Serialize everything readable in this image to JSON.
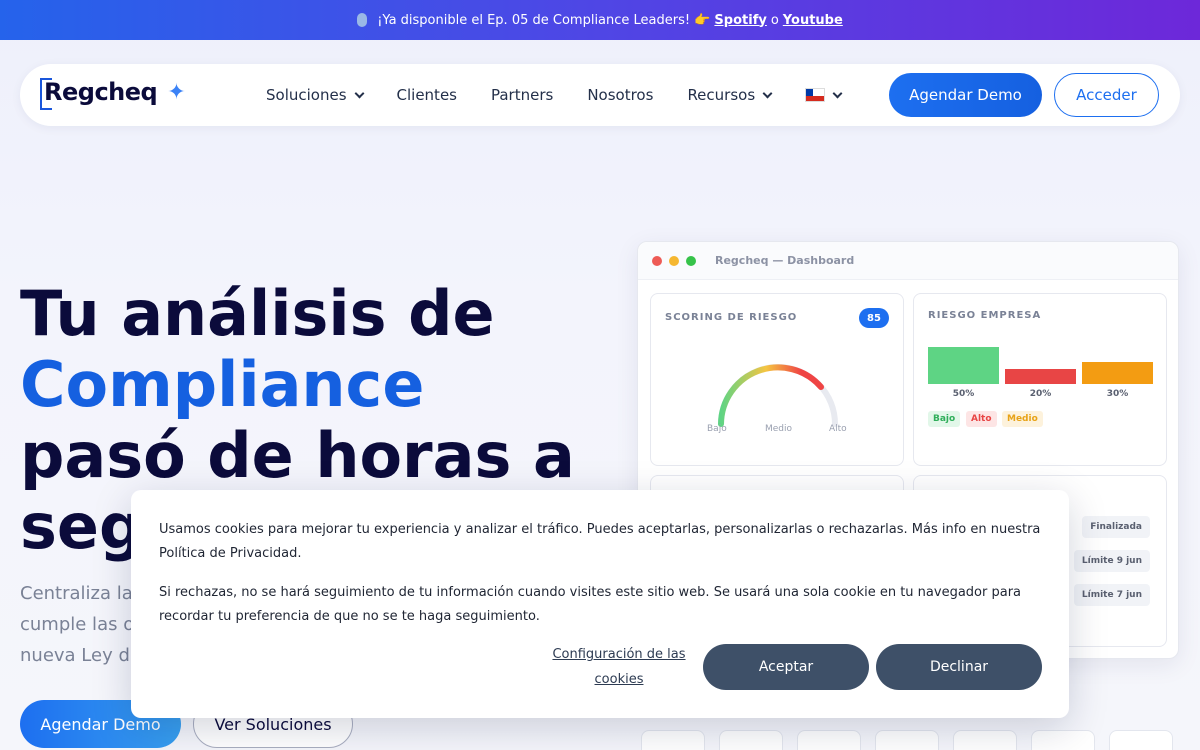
{
  "announcement": {
    "text": "¡Ya disponible el Ep. 05 de Compliance Leaders! 👉",
    "link1": "Spotify",
    "connector": "o",
    "link2": "Youtube"
  },
  "nav": {
    "logo": "Regcheq",
    "items": [
      "Soluciones",
      "Clientes",
      "Partners",
      "Nosotros",
      "Recursos"
    ],
    "cta_primary": "Agendar Demo",
    "cta_secondary": "Acceder"
  },
  "hero": {
    "title_line1": "Tu análisis de",
    "title_highlight": "Compliance",
    "title_line3": "pasó de horas a",
    "title_line4": "segundos",
    "subtitle_line1": "Centraliza la",
    "subtitle_line2": "cumple las o",
    "subtitle_line3": "nueva Ley d",
    "btn_primary": "Agendar Demo",
    "btn_secondary": "Ver Soluciones"
  },
  "dashboard": {
    "window_title": "Regcheq — Dashboard",
    "scoring": {
      "label": "SCORING DE RIESGO",
      "score": "85",
      "gauge_labels": [
        "Bajo",
        "Medio",
        "Alto"
      ]
    },
    "riesgo_empresa": {
      "label": "RIESGO EMPRESA",
      "bars": [
        {
          "pct": "50%",
          "value": 50,
          "color": "#5ed484"
        },
        {
          "pct": "20%",
          "value": 20,
          "color": "#e84545"
        },
        {
          "pct": "30%",
          "value": 30,
          "color": "#f39c12"
        }
      ],
      "tags": [
        {
          "text": "Bajo",
          "color": "#2fae5a",
          "bg": "#e2f7e9"
        },
        {
          "text": "Alto",
          "color": "#e84545",
          "bg": "#fde5e5"
        },
        {
          "text": "Medio",
          "color": "#e8a317",
          "bg": "#fdf2dc"
        }
      ]
    },
    "status": [
      "Finalizada",
      "Límite 9 jun",
      "Límite 7 jun"
    ]
  },
  "cookie": {
    "p1": "Usamos cookies para mejorar tu experiencia y analizar el tráfico. Puedes aceptarlas, personalizarlas o rechazarlas. Más info en nuestra Política de Privacidad.",
    "p2": "Si rechazas, no se hará seguimiento de tu información cuando visites este sitio web. Se usará una sola cookie en tu navegador para recordar tu preferencia de que no se te haga seguimiento.",
    "config": "Configuración de las cookies",
    "accept": "Aceptar",
    "decline": "Declinar"
  }
}
